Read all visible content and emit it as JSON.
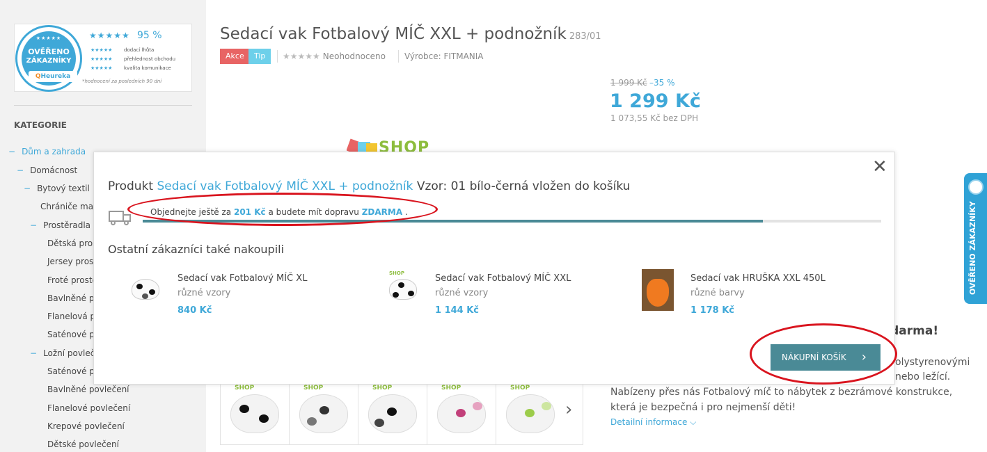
{
  "heureka": {
    "badge_line1": "OVĚŘENO",
    "badge_line2": "ZÁKAZNÍKY",
    "badge_brand": "Heureka",
    "stars": "★★★★★",
    "percent": "95 %",
    "rows": [
      "dodací lhůta",
      "přehlednost obchodu",
      "kvalita komunikace"
    ],
    "note": "*hodnocení za posledních 90 dní"
  },
  "sidebar": {
    "heading": "KATEGORIE",
    "items": [
      {
        "label": "Dům a zahrada",
        "marker": "−",
        "blue": true
      },
      {
        "label": "Domácnost",
        "marker": "−",
        "blue": false
      },
      {
        "label": "Bytový textil",
        "marker": "−",
        "blue": false
      },
      {
        "label": "Chrániče mat",
        "marker": "",
        "blue": false
      },
      {
        "label": "Prostěradla",
        "marker": "−",
        "blue": false
      },
      {
        "label": "Dětská pros",
        "marker": "",
        "blue": false
      },
      {
        "label": "Jersey pros",
        "marker": "",
        "blue": false
      },
      {
        "label": "Froté prostě",
        "marker": "",
        "blue": false
      },
      {
        "label": "Bavlněné p",
        "marker": "",
        "blue": false
      },
      {
        "label": "Flanelová p",
        "marker": "",
        "blue": false
      },
      {
        "label": "Saténové p",
        "marker": "",
        "blue": false
      },
      {
        "label": "Ložní povleče",
        "marker": "−",
        "blue": false
      },
      {
        "label": "Saténové po",
        "marker": "",
        "blue": false
      },
      {
        "label": "Bavlněné povlečení",
        "marker": "",
        "blue": false
      },
      {
        "label": "Flanelové povlečení",
        "marker": "",
        "blue": false
      },
      {
        "label": "Krepové povlečení",
        "marker": "",
        "blue": false
      },
      {
        "label": "Dětské povlečení",
        "marker": "",
        "blue": false
      }
    ]
  },
  "product": {
    "title": "Sedací vak Fotbalový MÍČ XXL + podnožník",
    "code": "283/01",
    "flag_akce": "Akce",
    "flag_tip": "Tip",
    "rating_stars": "★★★★★",
    "rating_text": "Neohodnoceno",
    "manufacturer": "Výrobce: FITMANIA",
    "old_price": "1 999 Kč",
    "discount": "–35 %",
    "price": "1 299 Kč",
    "price_no_vat": "1 073,55 Kč bez DPH",
    "logo_text": "SHOP"
  },
  "background": {
    "heading_fragment": "k zdarma!",
    "text1_fragment": "olystyrenovými",
    "text2_fragment": "nebo ležící.",
    "description": "Nabízeny přes nás Fotbalový míč to nábytek z bezrámové konstrukce, která je bezpečná i pro nejmenší děti!",
    "detail_link": "Detailní informace",
    "side_tab": "OVĚŘENO ZÁKAZNÍKY",
    "thumb_label": "SHOP"
  },
  "modal": {
    "title_prefix": "Produkt",
    "title_link": "Sedací vak Fotbalový MÍČ XXL + podnožník",
    "title_suffix": "Vzor: 01 bílo-černá vložen do košíku",
    "shipping_before": "Objednejte ještě za",
    "shipping_amount": "201 Kč",
    "shipping_middle": "a budete mít dopravu",
    "shipping_free": "ZDARMA",
    "shipping_after": ".",
    "progress_fraction": 0.84,
    "also_bought": "Ostatní zákazníci také nakoupili",
    "recommendations": [
      {
        "name": "Sedací vak Fotbalový MÍČ XL",
        "variant": "různé vzory",
        "price": "840 Kč"
      },
      {
        "name": "Sedací vak Fotbalový MÍČ XXL",
        "variant": "různé vzory",
        "price": "1 144 Kč"
      },
      {
        "name": "Sedací vak HRUŠKA XXL 450L",
        "variant": "různé barvy",
        "price": "1 178 Kč"
      }
    ],
    "cart_button": "NÁKUPNÍ KOŠÍK",
    "close_icon": "close-icon"
  },
  "colors": {
    "accent": "#3fa8d8",
    "button": "#4a8a96",
    "highlight_oval": "#d9141e"
  }
}
